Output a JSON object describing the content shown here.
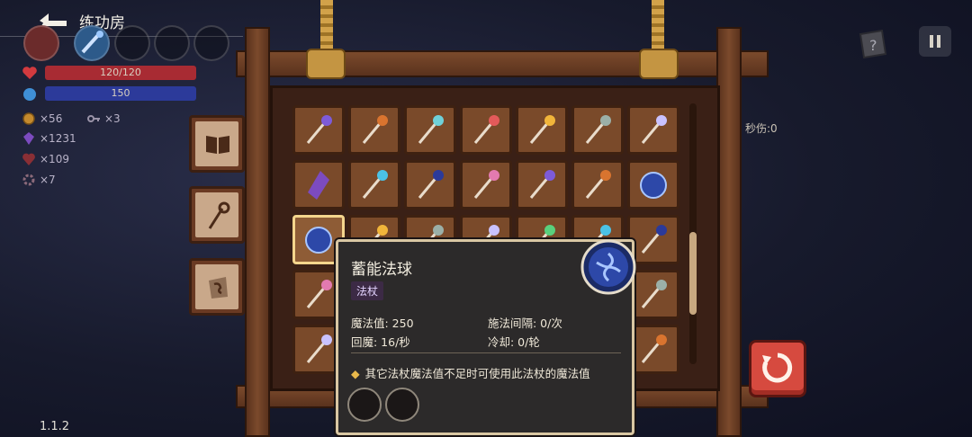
{
  "header": {
    "title": "练功房",
    "back_icon": "back-arrow-icon",
    "help_icon": "help-book-icon",
    "pause_icon": "pause-icon"
  },
  "player": {
    "hp_text": "120/120",
    "hp_fraction": 1.0,
    "mp_text": "150",
    "mp_fraction": 1.0,
    "hp_color": "#d33a3f",
    "mp_color": "#3b4ab8",
    "resources": [
      {
        "icon": "gold-coin-icon",
        "value": "×56"
      },
      {
        "icon": "key-icon",
        "value": "×3"
      },
      {
        "icon": "purple-crystal-icon",
        "value": "×1231"
      },
      {
        "icon": "heart-potion-icon",
        "value": "×109"
      },
      {
        "icon": "cog-token-icon",
        "value": "×7"
      }
    ]
  },
  "side_tabs": [
    {
      "icon": "book-icon"
    },
    {
      "icon": "staff-icon"
    },
    {
      "icon": "rune-stone-icon"
    }
  ],
  "inventory": {
    "rows": [
      [
        "gem-scepter-icon",
        "fire-wand-icon",
        "ice-trident-icon",
        "crystal-torch-icon",
        "rainbow-cone-icon",
        "thin-rod-icon",
        "pink-mace-icon"
      ],
      [
        "purple-crystal-icon",
        "vine-staff-icon",
        "jade-ruler-icon",
        "shuriken-staff-icon",
        "curved-blade-icon",
        "ornate-staff-icon",
        "vortex-orb-icon"
      ],
      [
        "charged-orb-icon",
        "flower-staff-icon",
        "hammer-icon",
        "rose-staff-icon",
        "tentacle-staff-icon",
        "cannon-icon",
        "blue-hand-staff-icon"
      ],
      [
        "spear-icon",
        "",
        "",
        "",
        "",
        "",
        "keyhole-icon"
      ],
      [
        "cross-staff-icon",
        "",
        "",
        "",
        "",
        "",
        "pink-crystal-staff-icon"
      ]
    ],
    "selected": "charged-orb-icon"
  },
  "tooltip": {
    "name": "蓄能法球",
    "tag": "法杖",
    "stats": [
      {
        "label": "魔法值: 250"
      },
      {
        "label": "施法间隔: 0/次"
      },
      {
        "label": "回魔: 16/秒"
      },
      {
        "label": "冷却: 0/轮"
      }
    ],
    "description": "其它法杖魔法值不足时可使用此法杖的魔法值",
    "orb_icon": "charged-orb-icon"
  },
  "dps_label": "秒伤:0",
  "refresh_icon": "refresh-icon",
  "version": "1.1.2",
  "colors": {
    "wood": "#7a4a2a",
    "wood_dark": "#3e2111",
    "accent_red": "#d64a3f",
    "tooltip_border": "#d9c7a3"
  }
}
